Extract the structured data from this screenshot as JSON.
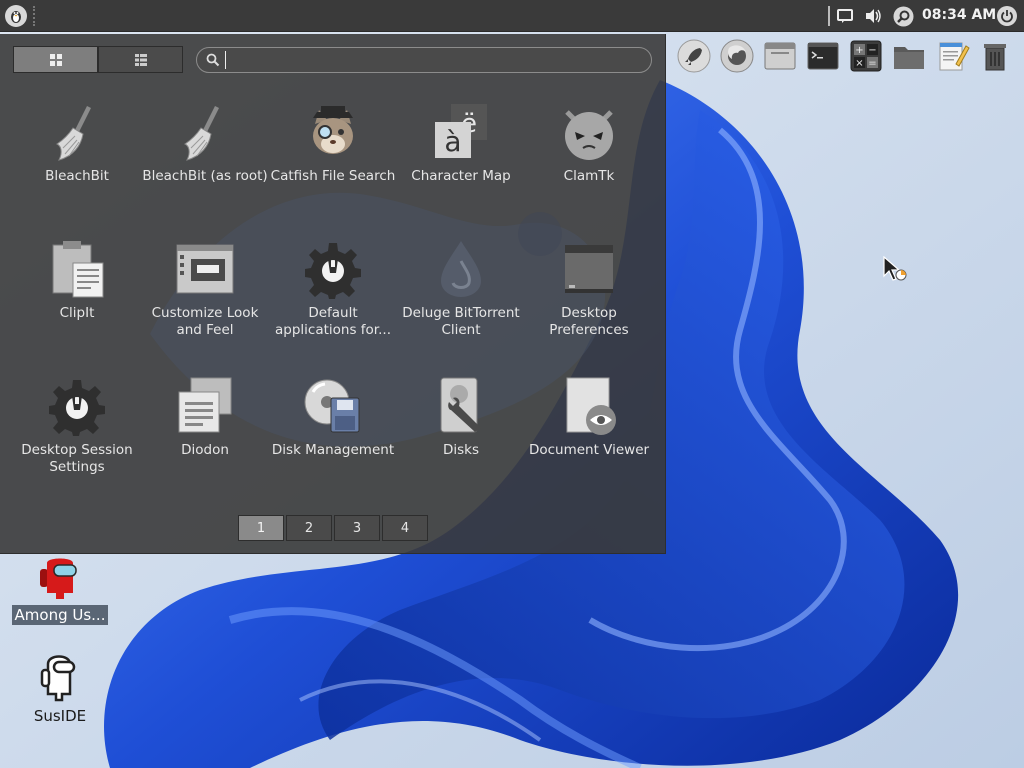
{
  "panel": {
    "clock": "08:34 AM",
    "tray_icons": [
      "notification-icon",
      "volume-icon",
      "search-icon"
    ]
  },
  "dock": {
    "items": [
      "launcher-rocket-icon",
      "firefox-icon",
      "window-icon",
      "terminal-icon",
      "calculator-icon",
      "file-manager-icon",
      "text-editor-icon",
      "trash-icon"
    ]
  },
  "launcher": {
    "search": {
      "value": "",
      "placeholder": ""
    },
    "apps": [
      {
        "label": "BleachBit",
        "icon": "broom-icon"
      },
      {
        "label": "BleachBit (as root)",
        "icon": "broom-icon"
      },
      {
        "label": "Catfish File Search",
        "icon": "catfish-icon"
      },
      {
        "label": "Character Map",
        "icon": "character-map-icon"
      },
      {
        "label": "ClamTk",
        "icon": "clamtk-icon"
      },
      {
        "label": "ClipIt",
        "icon": "clipboard-icon"
      },
      {
        "label": "Customize Look and Feel",
        "icon": "appearance-icon"
      },
      {
        "label": "Default applications for...",
        "icon": "gear-icon"
      },
      {
        "label": "Deluge BitTorrent Client",
        "icon": "deluge-icon"
      },
      {
        "label": "Desktop Preferences",
        "icon": "desktop-preferences-icon"
      },
      {
        "label": "Desktop Session Settings",
        "icon": "session-gear-icon"
      },
      {
        "label": "Diodon",
        "icon": "diodon-icon"
      },
      {
        "label": "Disk Management",
        "icon": "disk-management-icon"
      },
      {
        "label": "Disks",
        "icon": "disks-icon"
      },
      {
        "label": "Document Viewer",
        "icon": "document-viewer-icon"
      }
    ],
    "pages": [
      "1",
      "2",
      "3",
      "4"
    ],
    "active_page": "1",
    "character_map_glyphs": {
      "front": "à",
      "back": "ë"
    }
  },
  "desktop": {
    "icons": [
      {
        "label": "Among Us...",
        "icon": "among-us-icon"
      },
      {
        "label": "SusIDE",
        "icon": "suside-icon"
      }
    ]
  },
  "colors": {
    "panel_bg": "#3a3a3a",
    "launcher_bg": "#3a3a3a",
    "wallpaper_accent": "#1f4fd6",
    "active_page": "#8a8a8a"
  }
}
